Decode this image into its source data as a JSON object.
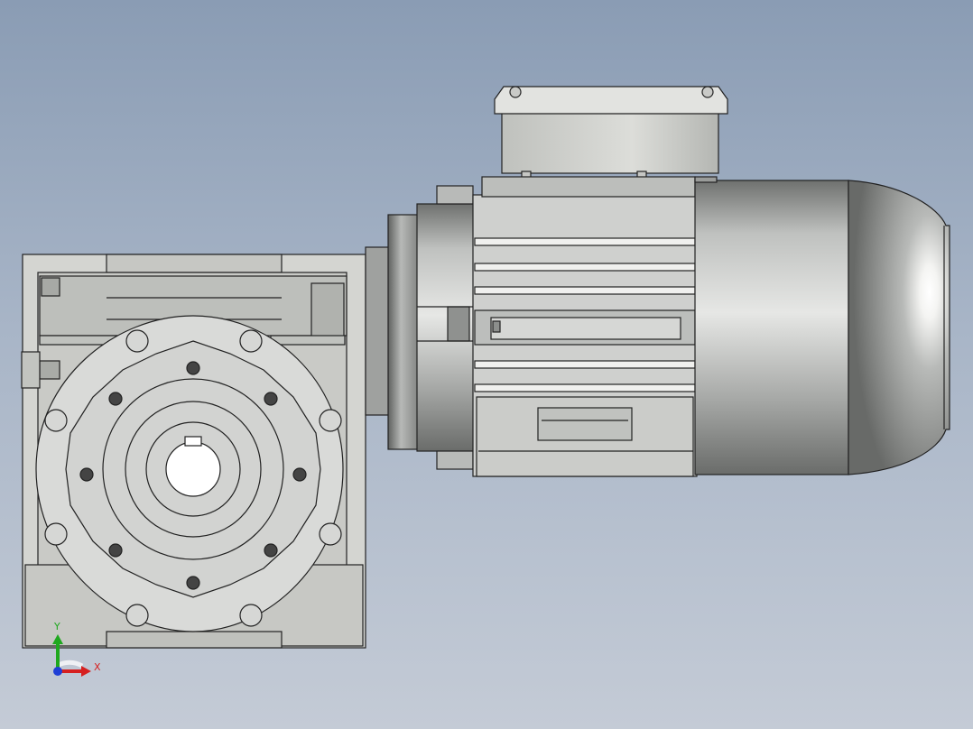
{
  "viewport": {
    "background_top": "#8a9cb4",
    "background_bottom": "#c4cbd6"
  },
  "model": {
    "body_color": "#d9dad8",
    "shadow_color": "#9a9c9a",
    "edge_color": "#222222"
  },
  "triad": {
    "x_label": "X",
    "y_label": "Y",
    "x_color": "#d62020",
    "y_color": "#1fa81f",
    "z_color": "#1f3fd6"
  }
}
